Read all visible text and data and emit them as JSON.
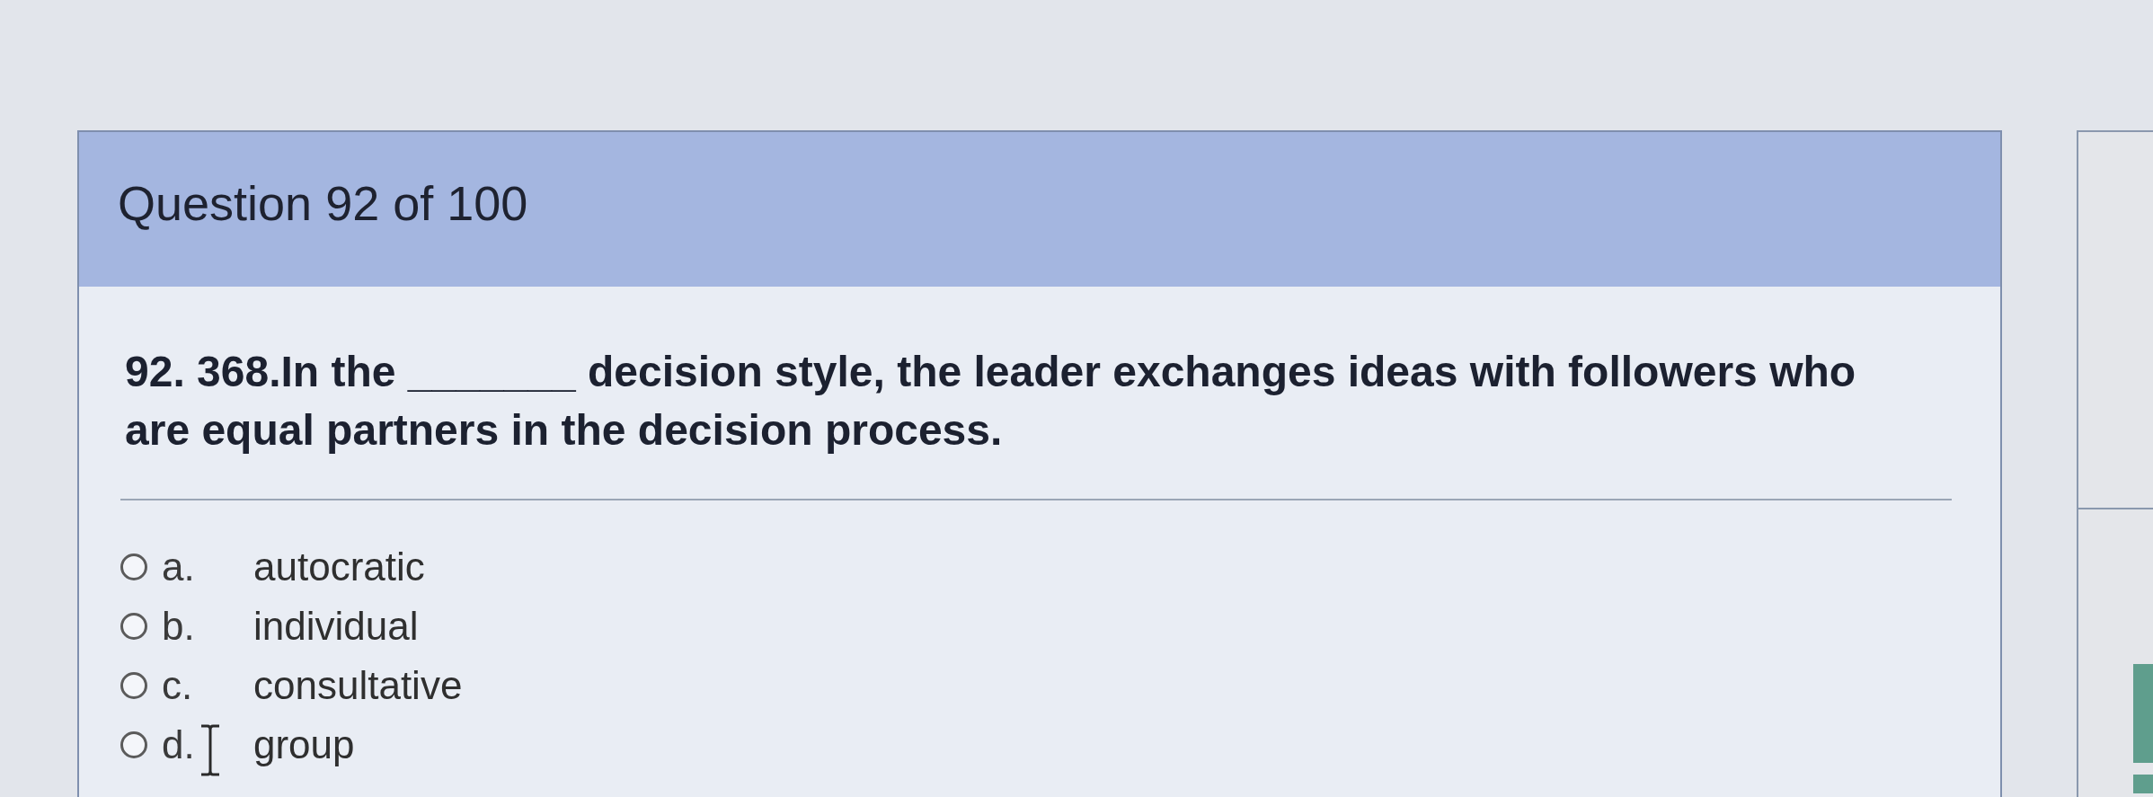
{
  "header": {
    "title": "Question 92 of 100"
  },
  "question": {
    "text": "92. 368.In the _______ decision style, the leader exchanges ideas with followers who are equal partners in the decision process."
  },
  "options": [
    {
      "letter": "a.",
      "text": "autocratic",
      "selected": false,
      "hovered": false
    },
    {
      "letter": "b.",
      "text": "individual",
      "selected": false,
      "hovered": false
    },
    {
      "letter": "c.",
      "text": "consultative",
      "selected": false,
      "hovered": false
    },
    {
      "letter": "d.",
      "text": "group",
      "selected": false,
      "hovered": true
    }
  ]
}
